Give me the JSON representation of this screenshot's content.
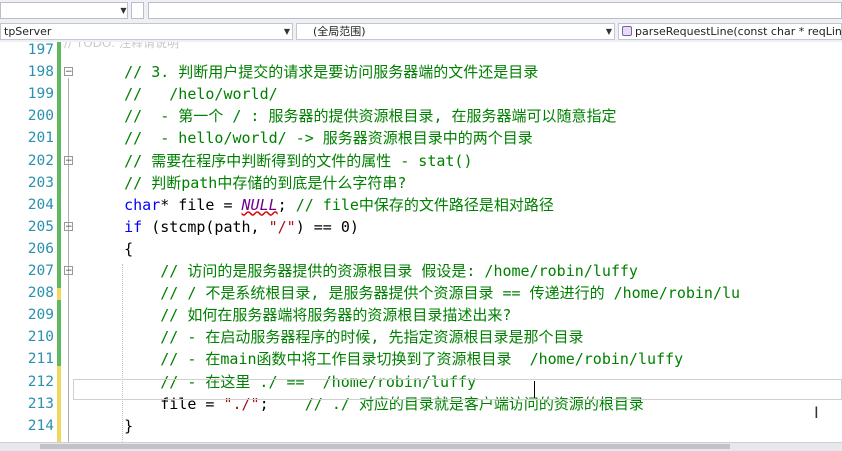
{
  "navigation": {
    "project": "tpServer",
    "scope": "(全局范围)",
    "member": "parseRequestLine(const char * reqLine)"
  },
  "editor": {
    "ghost_text": "// TODO: 注释请说明",
    "lines": [
      {
        "num": "197",
        "segments": []
      },
      {
        "num": "198",
        "fold": "−",
        "segments": [
          {
            "t": "    // 3. 判断用户提交的请求是要访问服务器端的文件还是目录",
            "c": "cm"
          }
        ]
      },
      {
        "num": "199",
        "segments": [
          {
            "t": "    //   /helo/world/",
            "c": "cm"
          }
        ]
      },
      {
        "num": "200",
        "segments": [
          {
            "t": "    //  - 第一个 / : 服务器的提供资源根目录, 在服务器端可以随意指定",
            "c": "cm"
          }
        ]
      },
      {
        "num": "201",
        "segments": [
          {
            "t": "    //  - hello/world/ -> 服务器资源根目录中的两个目录",
            "c": "cm"
          }
        ]
      },
      {
        "num": "202",
        "fold": "−",
        "segments": [
          {
            "t": "    // 需要在程序中判断得到的文件的属性 - stat()",
            "c": "cm"
          }
        ]
      },
      {
        "num": "203",
        "segments": [
          {
            "t": "    // 判断path中存储的到底是什么字符串?",
            "c": "cm"
          }
        ]
      },
      {
        "num": "204",
        "segments": [
          {
            "t": "    ",
            "c": ""
          },
          {
            "t": "char",
            "c": "kw"
          },
          {
            "t": "* file = ",
            "c": ""
          },
          {
            "t": "NULL",
            "c": "nul"
          },
          {
            "t": "; ",
            "c": ""
          },
          {
            "t": "// file中保存的文件路径是相对路径",
            "c": "cm"
          }
        ]
      },
      {
        "num": "205",
        "fold": "−",
        "segments": [
          {
            "t": "    ",
            "c": ""
          },
          {
            "t": "if",
            "c": "kw"
          },
          {
            "t": " (stcmp(path, ",
            "c": ""
          },
          {
            "t": "\"/\"",
            "c": "str"
          },
          {
            "t": ") == 0)",
            "c": ""
          }
        ]
      },
      {
        "num": "206",
        "segments": [
          {
            "t": "    {",
            "c": ""
          }
        ]
      },
      {
        "num": "207",
        "fold": "−",
        "segments": [
          {
            "t": "        // 访问的是服务器提供的资源根目录 假设是: /home/robin/luffy",
            "c": "cm"
          }
        ]
      },
      {
        "num": "208",
        "segments": [
          {
            "t": "        // / 不是系统根目录, 是服务器提供个资源目录 == 传递进行的 /home/robin/lu",
            "c": "cm"
          }
        ]
      },
      {
        "num": "209",
        "segments": [
          {
            "t": "        // 如何在服务器端将服务器的资源根目录描述出来?",
            "c": "cm"
          }
        ]
      },
      {
        "num": "210",
        "segments": [
          {
            "t": "        // - 在启动服务器程序的时候, 先指定资源根目录是那个目录",
            "c": "cm"
          }
        ]
      },
      {
        "num": "211",
        "segments": [
          {
            "t": "        // - 在main函数中将工作目录切换到了资源根目录  /home/robin/luffy",
            "c": "cm"
          }
        ]
      },
      {
        "num": "212",
        "segments": [
          {
            "t": "        // - 在这里 ./ ==  /home/robin/luffy",
            "c": "cm"
          }
        ]
      },
      {
        "num": "213",
        "segments": [
          {
            "t": "        file = ",
            "c": ""
          },
          {
            "t": "\"./\"",
            "c": "str"
          },
          {
            "t": ";    ",
            "c": ""
          },
          {
            "t": "// ./ 对应的目录就是客户端访问的资源的根目录",
            "c": "cm"
          }
        ]
      },
      {
        "num": "214",
        "segments": [
          {
            "t": "    }",
            "c": ""
          }
        ]
      }
    ]
  }
}
